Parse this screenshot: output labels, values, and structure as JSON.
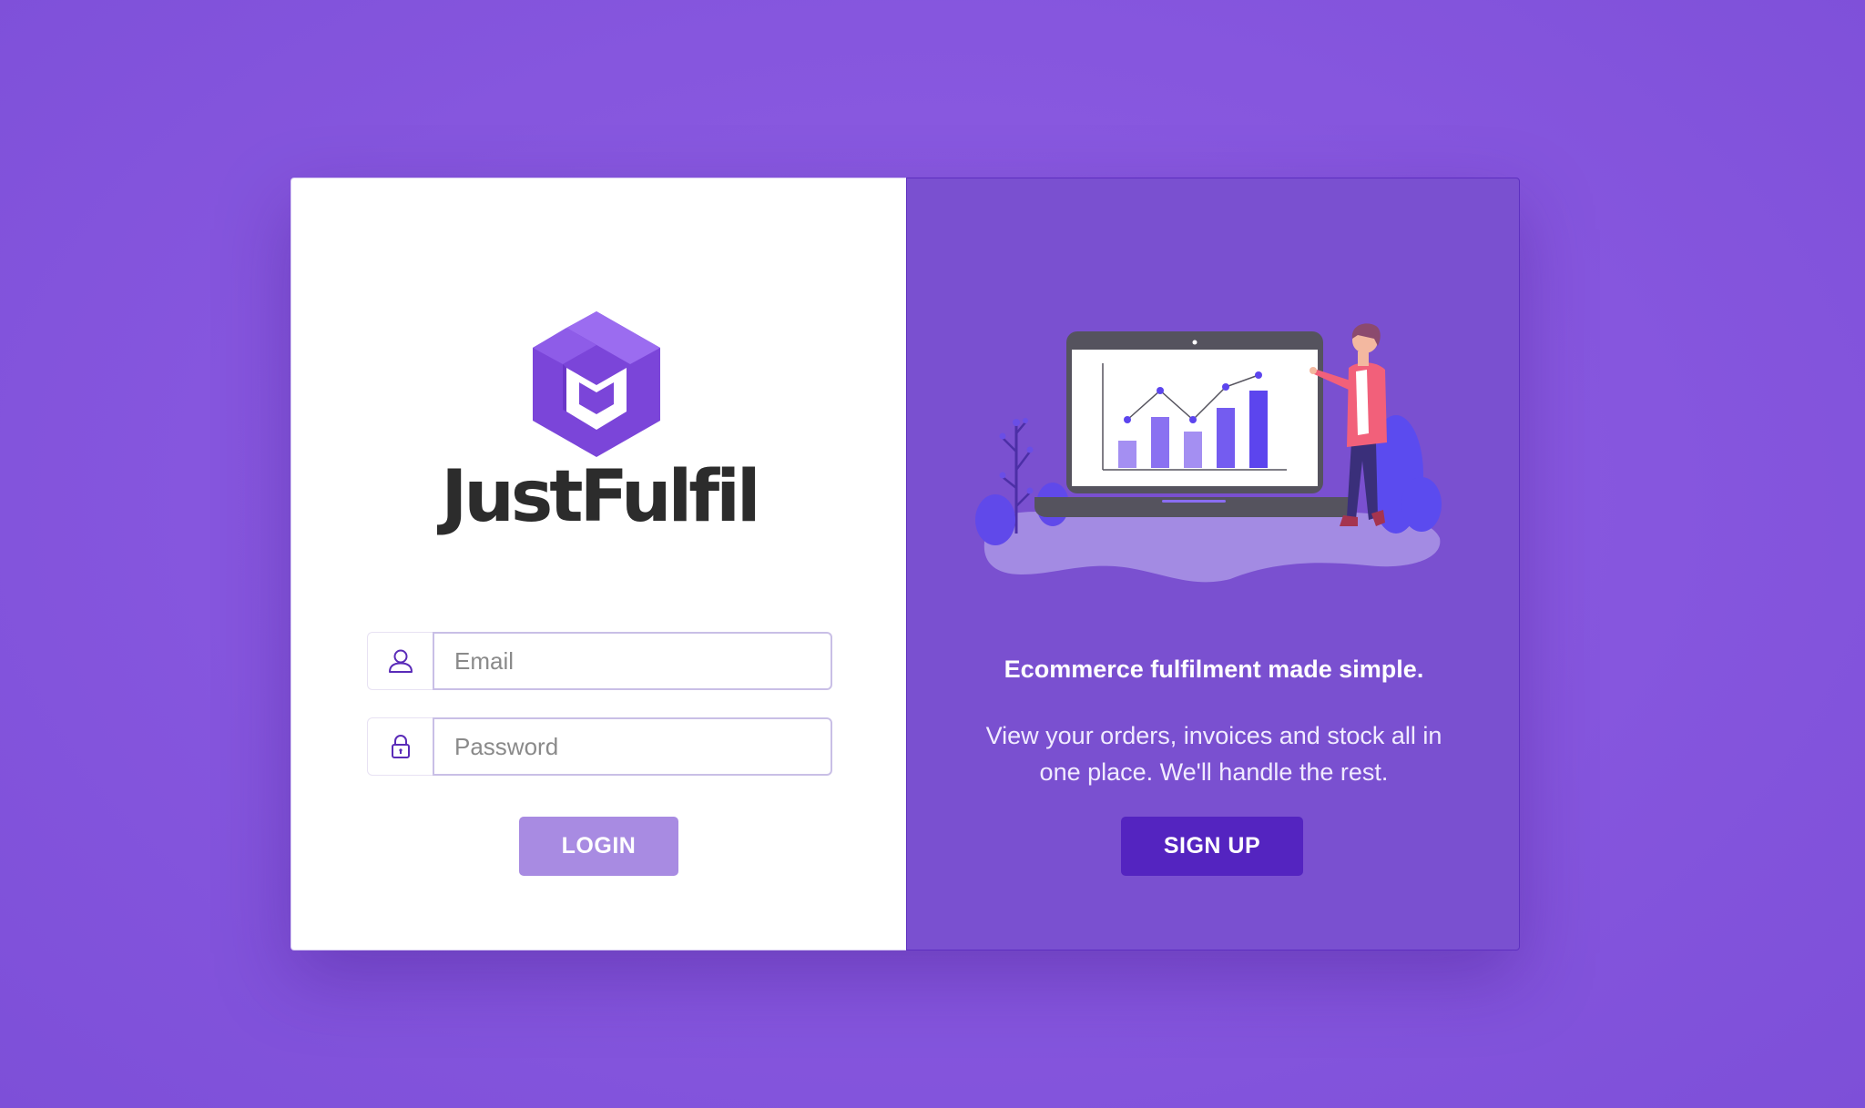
{
  "brand": {
    "name": "JustFulfil",
    "logo_icon": "cube-box-icon"
  },
  "login_form": {
    "email": {
      "placeholder": "Email",
      "value": "",
      "icon": "user-icon"
    },
    "password": {
      "placeholder": "Password",
      "value": "",
      "icon": "lock-icon"
    },
    "login_label": "LOGIN"
  },
  "promo": {
    "illustration": "presenter-chart-illustration",
    "tagline": "Ecommerce fulfilment made simple.",
    "description": "View your orders, invoices and stock all in one place. We'll handle the rest.",
    "signup_label": "SIGN UP"
  },
  "colors": {
    "background": "#8656de",
    "accent": "#7a50d0",
    "signup_button": "#5424c0",
    "login_button": "#a88be2",
    "logo_purple": "#7b45d9"
  }
}
